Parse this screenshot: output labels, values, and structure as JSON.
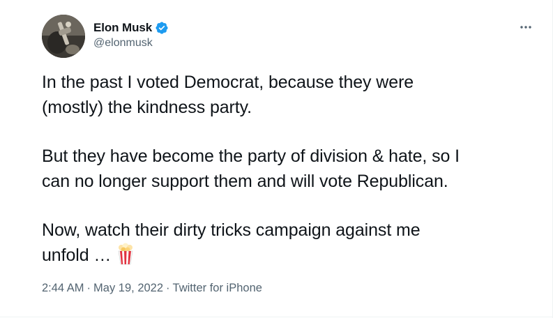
{
  "author": {
    "display_name": "Elon Musk",
    "handle": "@elonmusk",
    "verified": true,
    "verified_icon": "verified-badge-icon",
    "verified_color": "#1d9bf0"
  },
  "menu": {
    "icon": "more-horizontal-icon"
  },
  "tweet": {
    "paragraphs": [
      {
        "lines": [
          "In the past I voted Democrat, because they were",
          "(mostly) the kindness party."
        ]
      },
      {
        "lines": [
          "But they have become the party of division & hate, so I",
          "can no longer support them and will vote Republican."
        ]
      },
      {
        "lines": [
          "Now, watch their dirty tricks campaign against me",
          "unfold …"
        ],
        "emoji": "popcorn-emoji"
      }
    ]
  },
  "meta": {
    "time": "2:44 AM",
    "separator": "·",
    "date": "May 19, 2022",
    "source": "Twitter for iPhone"
  },
  "colors": {
    "text": "#0f1419",
    "secondary": "#536471",
    "accent": "#1d9bf0",
    "divider": "#eff3f4"
  }
}
